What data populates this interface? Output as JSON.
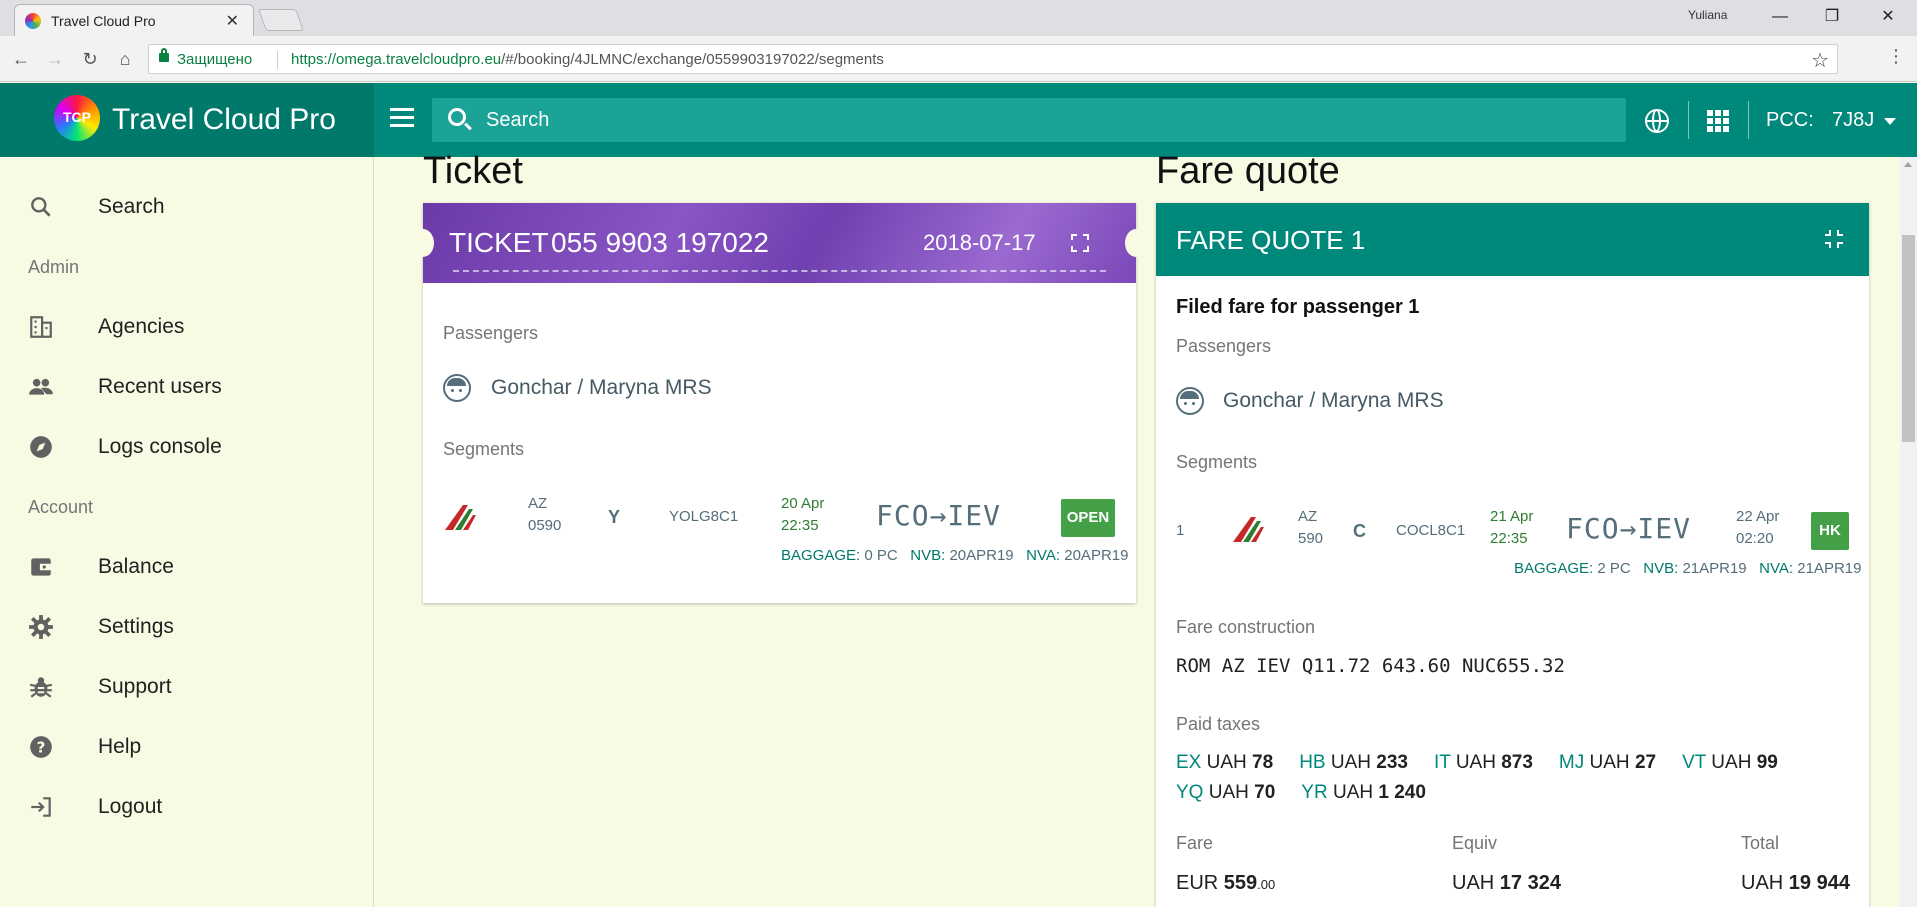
{
  "browser": {
    "tab_title": "Travel Cloud Pro",
    "user": "Yuliana",
    "secure_label": "Защищено",
    "url_host": "https://omega.travelcloudpro.eu",
    "url_path": "/#/booking/4JLMNC/exchange/0559903197022/segments"
  },
  "header": {
    "logo_text": "TCP",
    "brand": "Travel Cloud Pro",
    "search_placeholder": "Search",
    "pcc_label": "PCC:",
    "pcc_value": "7J8J"
  },
  "sidebar": {
    "search": "Search",
    "admin_section": "Admin",
    "agencies": "Agencies",
    "recent_users": "Recent users",
    "logs_console": "Logs console",
    "account_section": "Account",
    "balance": "Balance",
    "settings": "Settings",
    "support": "Support",
    "help": "Help",
    "logout": "Logout"
  },
  "ticket": {
    "section_title": "Ticket",
    "header_label": "TICKET",
    "number": "055 9903 197022",
    "date": "2018-07-17",
    "passengers_label": "Passengers",
    "passenger": "Gonchar / Maryna MRS",
    "segments_label": "Segments",
    "segment": {
      "airline": "AZ",
      "flight": "0590",
      "class": "Y",
      "fare_basis": "YOLG8C1",
      "dep_date": "20 Apr",
      "dep_time": "22:35",
      "route": "FCO→IEV",
      "status": "OPEN",
      "baggage_label": "BAGGAGE:",
      "baggage": "0 PC",
      "nvb_label": "NVB:",
      "nvb": "20APR19",
      "nva_label": "NVA:",
      "nva": "20APR19"
    }
  },
  "fare_quote": {
    "section_title": "Fare quote",
    "header": "FARE QUOTE 1",
    "filed_fare": "Filed fare for passenger 1",
    "passengers_label": "Passengers",
    "passenger": "Gonchar / Maryna MRS",
    "segments_label": "Segments",
    "segment": {
      "index": "1",
      "airline": "AZ",
      "flight": "590",
      "class": "C",
      "fare_basis": "COCL8C1",
      "dep_date": "21 Apr",
      "dep_time": "22:35",
      "route": "FCO→IEV",
      "arr_date": "22 Apr",
      "arr_time": "02:20",
      "status": "HK",
      "baggage_label": "BAGGAGE:",
      "baggage": "2 PC",
      "nvb_label": "NVB:",
      "nvb": "21APR19",
      "nva_label": "NVA:",
      "nva": "21APR19"
    },
    "fare_construction_label": "Fare construction",
    "fare_construction": "ROM AZ IEV Q11.72 643.60 NUC655.32",
    "paid_taxes_label": "Paid taxes",
    "taxes_row1": [
      {
        "code": "EX",
        "cur": "UAH",
        "amount": "78"
      },
      {
        "code": "HB",
        "cur": "UAH",
        "amount": "233"
      },
      {
        "code": "IT",
        "cur": "UAH",
        "amount": "873"
      },
      {
        "code": "MJ",
        "cur": "UAH",
        "amount": "27"
      },
      {
        "code": "VT",
        "cur": "UAH",
        "amount": "99"
      }
    ],
    "taxes_row2": [
      {
        "code": "YQ",
        "cur": "UAH",
        "amount": "70"
      },
      {
        "code": "YR",
        "cur": "UAH",
        "amount": "1 240"
      }
    ],
    "fare_label": "Fare",
    "fare_cur": "EUR",
    "fare_amount": "559",
    "fare_cents": ".00",
    "equiv_label": "Equiv",
    "equiv_cur": "UAH",
    "equiv_amount": "17 324",
    "total_label": "Total",
    "total_cur": "UAH",
    "total_amount": "19 944"
  },
  "colors": {
    "primary": "#00897b",
    "primary_dark": "#00796b",
    "ticket_purple": "#7b48b8",
    "status_green": "#43a047",
    "page_bg": "#f8fae4"
  }
}
